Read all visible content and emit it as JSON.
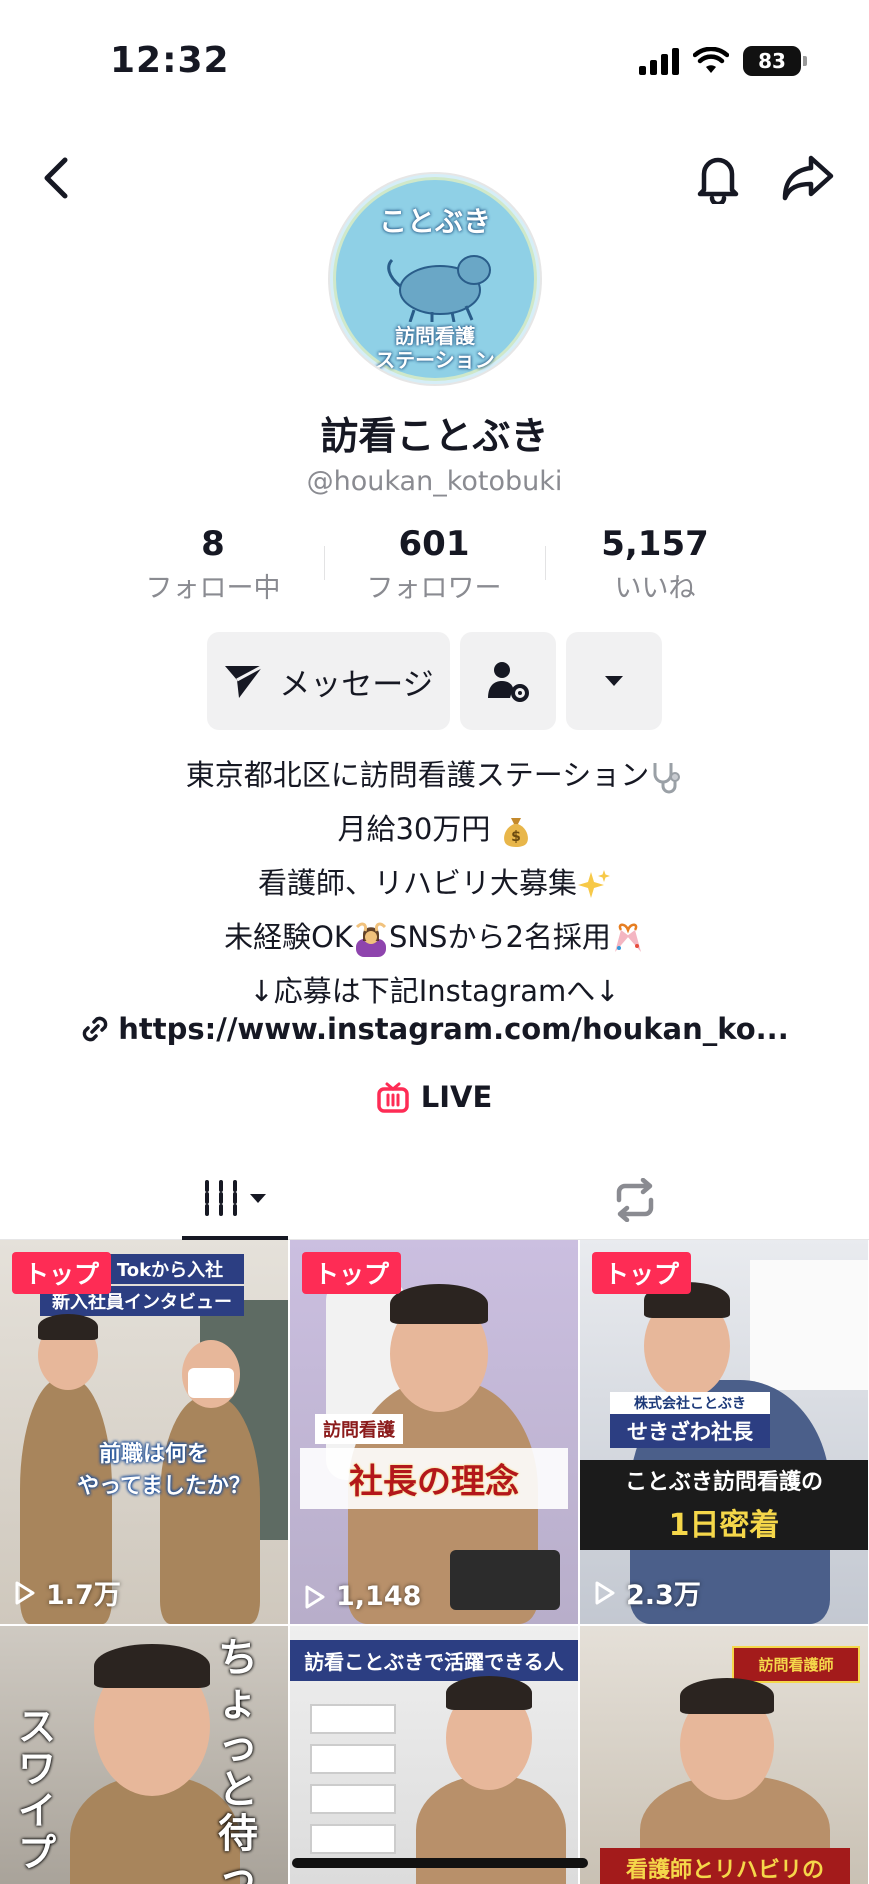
{
  "status_bar": {
    "time": "12:32",
    "battery": "83"
  },
  "profile": {
    "avatar_text_top": "ことぶき",
    "avatar_text_bottom_1": "訪問看護",
    "avatar_text_bottom_2": "ステーション",
    "display_name": "訪看ことぶき",
    "handle": "@houkan_kotobuki"
  },
  "stats": [
    {
      "value": "8",
      "label": "フォロー中"
    },
    {
      "value": "601",
      "label": "フォロワー"
    },
    {
      "value": "5,157",
      "label": "いいね"
    }
  ],
  "actions": {
    "message_label": "メッセージ"
  },
  "bio": {
    "lines": [
      "東京都北区に訪問看護ステーション",
      "月給30万円",
      "看護師、リハビリ大募集",
      "未経験OK",
      "SNSから2名採用",
      "↓応募は下記Instagramへ↓"
    ],
    "link": "https://www.instagram.com/houkan_ko...",
    "live_label": "LIVE"
  },
  "icons": {
    "back": "chevron-left-icon",
    "bell": "bell-icon",
    "share": "share-arrow-icon",
    "send": "send-icon",
    "friend_settings": "person-gear-icon",
    "dropdown": "caret-down-icon",
    "link": "link-icon",
    "live": "tv-icon",
    "grid": "grid-bars-icon",
    "repost": "repost-icon",
    "play": "play-icon"
  },
  "colors": {
    "accent": "#fe2c55",
    "text": "#161823",
    "secondary": "#8a8b91",
    "button_bg": "#f1f1f2"
  },
  "videos": [
    {
      "badge": "トップ",
      "views": "1.7万",
      "caption_1": "Tokから入社",
      "caption_2": "新入社員インタビュー",
      "caption_3": "前職は何を",
      "caption_4": "やってましたか？"
    },
    {
      "badge": "トップ",
      "views": "1,148",
      "caption_1": "訪問看護",
      "caption_2": "社長の理念"
    },
    {
      "badge": "トップ",
      "views": "2.3万",
      "caption_1": "株式会社ことぶき",
      "caption_2": "せきざわ社長",
      "caption_3": "ことぶき訪問看護の",
      "caption_4": "1日密着"
    },
    {
      "caption_1": "ちょっと待っ",
      "caption_2": "スワイプ"
    },
    {
      "caption_1": "訪看ことぶきで活躍できる人"
    },
    {
      "caption_1": "訪問看護師",
      "caption_2": "看護師とリハビリの"
    }
  ]
}
